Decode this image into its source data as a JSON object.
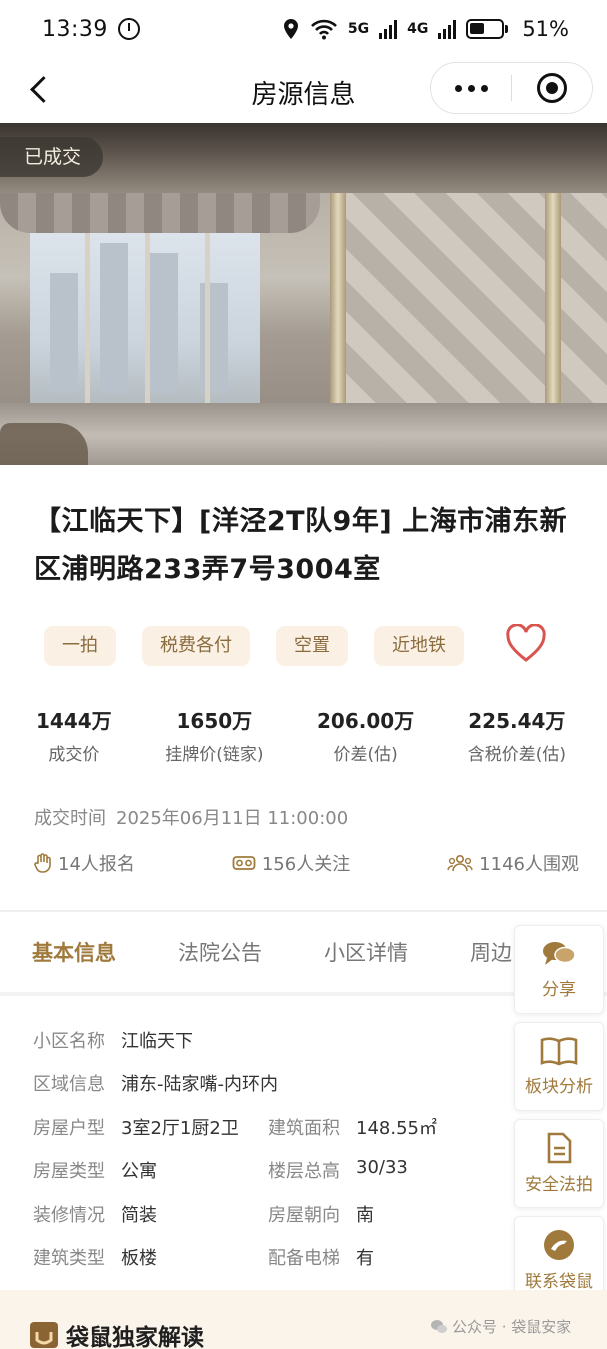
{
  "status_bar": {
    "time": "13:39",
    "network_1": "5G",
    "network_2": "4G",
    "battery": "51%"
  },
  "navbar": {
    "title": "房源信息"
  },
  "hero": {
    "badge": "已成交"
  },
  "listing": {
    "title": "【江临天下】[洋泾2T队9年] 上海市浦东新区浦明路233弄7号3004室",
    "tags": [
      "一拍",
      "税费各付",
      "空置",
      "近地铁"
    ]
  },
  "stats": [
    {
      "value": "1444万",
      "label": "成交价"
    },
    {
      "value": "1650万",
      "label": "挂牌价(链家)"
    },
    {
      "value": "206.00万",
      "label": "价差(估)"
    },
    {
      "value": "225.44万",
      "label": "含税价差(估)"
    }
  ],
  "deal": {
    "label": "成交时间",
    "time": "2025年06月11日 11:00:00"
  },
  "engagement": {
    "signups": "14人报名",
    "follows": "156人关注",
    "views": "1146人围观"
  },
  "tabs": [
    "基本信息",
    "法院公告",
    "小区详情",
    "周边"
  ],
  "basic_info": {
    "community_label": "小区名称",
    "community": "江临天下",
    "region_label": "区域信息",
    "region": "浦东-陆家嘴-内环内",
    "layout_label": "房屋户型",
    "layout": "3室2厅1厨2卫",
    "area_label": "建筑面积",
    "area": "148.55㎡",
    "type_label": "房屋类型",
    "type": "公寓",
    "floors_label": "楼层总高",
    "floors": "30/33",
    "decor_label": "装修情况",
    "decor": "简装",
    "orient_label": "房屋朝向",
    "orient": "南",
    "build_label": "建筑类型",
    "build": "板楼",
    "elevator_label": "配备电梯",
    "elevator": "有"
  },
  "sidebar": {
    "share": "分享",
    "analysis": "板块分析",
    "safe_auction": "安全法拍",
    "contact": "联系袋鼠"
  },
  "banner": {
    "title": "袋鼠独家解读",
    "watermark": "公众号 · 袋鼠安家"
  },
  "colors": {
    "accent": "#a07a3c",
    "tag_bg": "#fbf0e4",
    "heart": "#d9534f"
  }
}
